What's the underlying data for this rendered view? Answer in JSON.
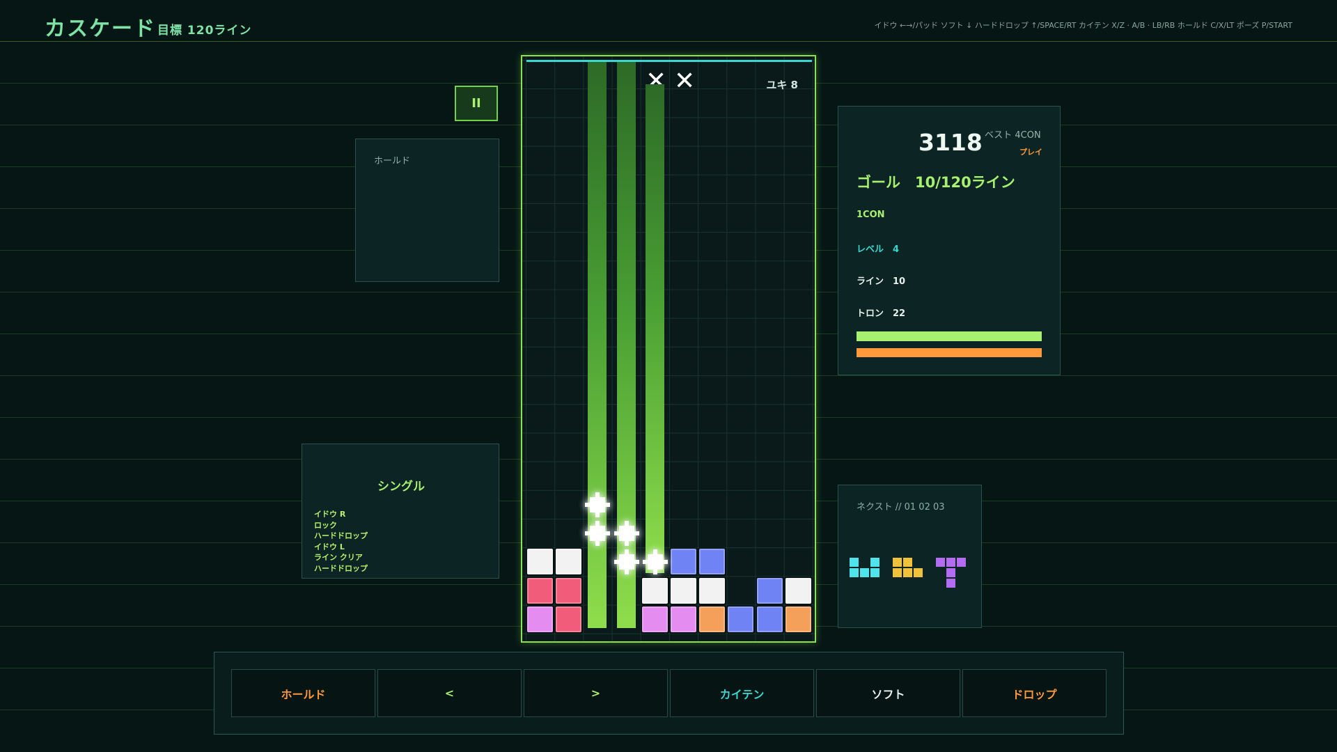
{
  "header": {
    "title": "カスケード",
    "subtitle": "目標 120ライン",
    "controls_help": "イドウ ←→/パッド ソフト ↓ ハードドロップ ↑/SPACE/RT カイテン X/Z · A/B · LB/RB ホールド C/X/LT ポーズ P/START"
  },
  "pause": {
    "label": "II"
  },
  "hold": {
    "label": "ホールド"
  },
  "event_log": {
    "title": "シングル",
    "items": [
      "イドウ R",
      "ロック",
      "ハードドロップ",
      "イドウ L",
      "ライン クリア",
      "ハードドロップ"
    ]
  },
  "board": {
    "danger_marks": [
      "✕",
      "✕"
    ],
    "remaining": "ユキ 8",
    "columns": 10,
    "rows": 20,
    "clearing_columns": [
      2,
      3,
      4
    ],
    "cells": [
      {
        "col": 0,
        "row": 17,
        "color": "white"
      },
      {
        "col": 1,
        "row": 17,
        "color": "white"
      },
      {
        "col": 5,
        "row": 17,
        "color": "blue"
      },
      {
        "col": 6,
        "row": 17,
        "color": "blue"
      },
      {
        "col": 0,
        "row": 18,
        "color": "red"
      },
      {
        "col": 1,
        "row": 18,
        "color": "red"
      },
      {
        "col": 4,
        "row": 18,
        "color": "white"
      },
      {
        "col": 5,
        "row": 18,
        "color": "white"
      },
      {
        "col": 6,
        "row": 18,
        "color": "white"
      },
      {
        "col": 8,
        "row": 18,
        "color": "blue"
      },
      {
        "col": 9,
        "row": 18,
        "color": "white"
      },
      {
        "col": 0,
        "row": 19,
        "color": "pink"
      },
      {
        "col": 1,
        "row": 19,
        "color": "red"
      },
      {
        "col": 4,
        "row": 19,
        "color": "pink"
      },
      {
        "col": 5,
        "row": 19,
        "color": "pink"
      },
      {
        "col": 6,
        "row": 19,
        "color": "orange"
      },
      {
        "col": 7,
        "row": 19,
        "color": "blue"
      },
      {
        "col": 8,
        "row": 19,
        "color": "blue"
      },
      {
        "col": 9,
        "row": 19,
        "color": "orange"
      }
    ],
    "sparks": [
      {
        "col": 2,
        "row": 15
      },
      {
        "col": 2,
        "row": 16
      },
      {
        "col": 3,
        "row": 16
      },
      {
        "col": 3,
        "row": 17
      },
      {
        "col": 4,
        "row": 17
      }
    ]
  },
  "stats": {
    "score": "3118",
    "best": "ベスト 4CON",
    "play": "プレイ",
    "goal": "ゴール　10/120ライン",
    "combo": "1CON",
    "level": "レベル　4",
    "lines": "ライン　10",
    "tron": "トロン　22",
    "bar_green": 1.0,
    "bar_orange": 1.0
  },
  "next": {
    "label": "ネクスト // 01 02 03",
    "pieces": [
      {
        "type": "Z-like",
        "color": "cyan",
        "cells": [
          [
            0,
            0
          ],
          [
            2,
            0
          ],
          [
            0,
            1
          ],
          [
            1,
            1
          ],
          [
            2,
            1
          ]
        ]
      },
      {
        "type": "P-like",
        "color": "yellow",
        "cells": [
          [
            0,
            0
          ],
          [
            1,
            0
          ],
          [
            0,
            1
          ],
          [
            1,
            1
          ],
          [
            2,
            1
          ]
        ]
      },
      {
        "type": "T",
        "color": "purple",
        "cells": [
          [
            0,
            0
          ],
          [
            1,
            0
          ],
          [
            2,
            0
          ],
          [
            1,
            1
          ],
          [
            1,
            2
          ]
        ]
      }
    ]
  },
  "controls": {
    "hold": "ホールド",
    "left": "<",
    "right": ">",
    "rotate": "カイテン",
    "soft": "ソフト",
    "drop": "ドロップ"
  },
  "colors": {
    "white": "#f2f2f2",
    "red": "#f05c7a",
    "pink": "#e48cf0",
    "blue": "#6f83f5",
    "orange": "#f5a05a",
    "cyan": "#4fe3ec",
    "yellow": "#f0c23c",
    "purple": "#b36cf2",
    "accent_green": "#a7f070",
    "accent_orange": "#ff9a3c",
    "accent_cyan": "#3ad7d0"
  }
}
